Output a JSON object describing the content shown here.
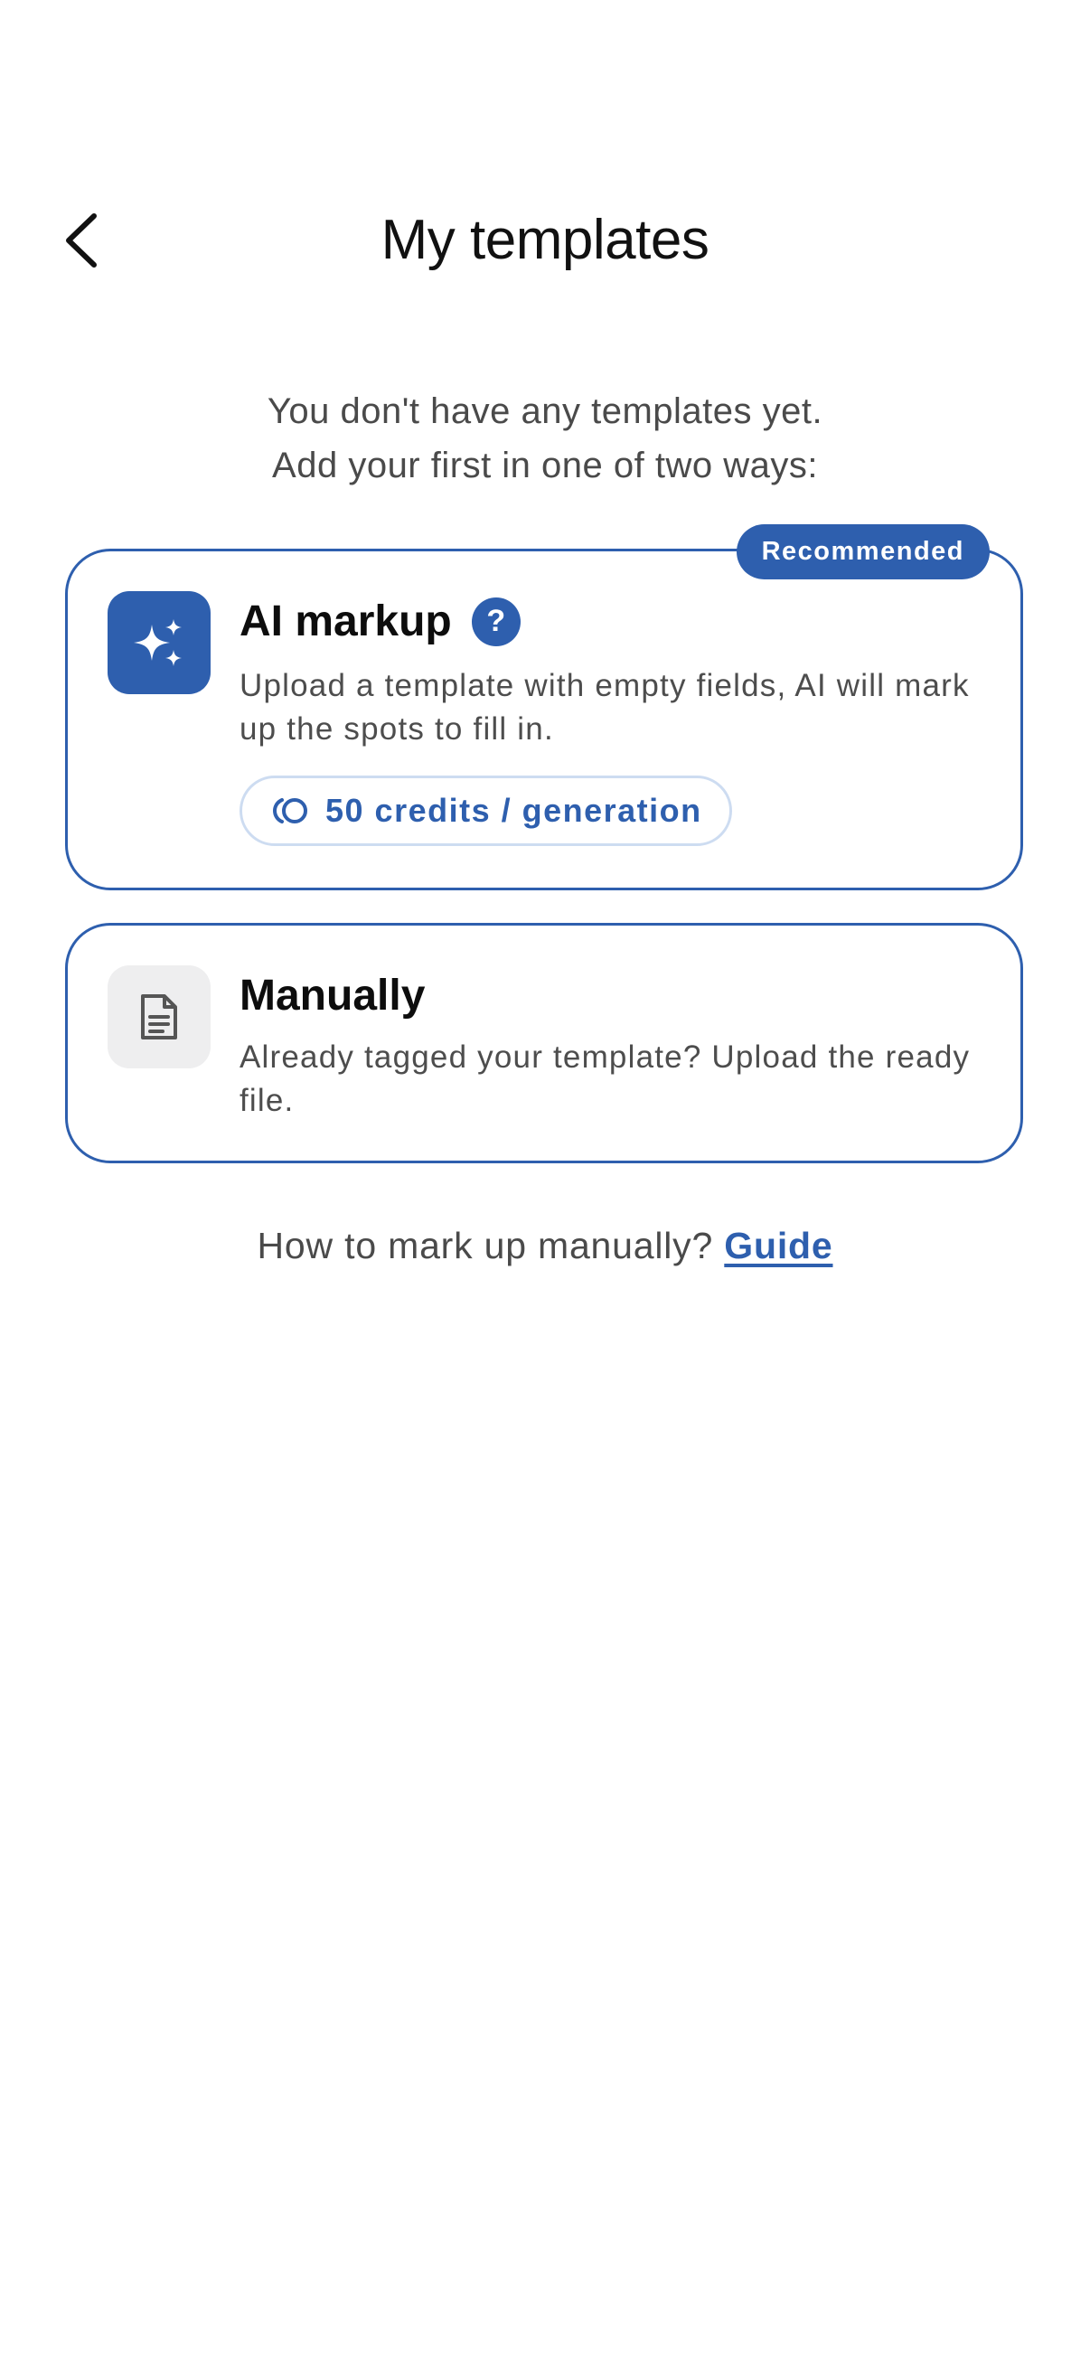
{
  "header": {
    "title": "My templates",
    "back_icon": "chevron-left-icon"
  },
  "intro": {
    "line1": "You don't have any templates yet.",
    "line2": "Add your first in one of two ways:"
  },
  "ai_card": {
    "badge": "Recommended",
    "icon": "sparkles-icon",
    "title": "AI markup",
    "help_icon": "?",
    "description": "Upload a template with empty fields, AI will mark up the spots to fill in.",
    "credits_icon": "coins-icon",
    "credits_label": "50 credits / generation"
  },
  "manual_card": {
    "icon": "document-icon",
    "title": "Manually",
    "description": "Already tagged your template? Upload the ready file."
  },
  "guide": {
    "prompt": "How to mark up manually?",
    "link_label": "Guide"
  },
  "colors": {
    "accent": "#2e5fae",
    "pill_border": "#cddcf1",
    "text_secondary": "#4d4d4d",
    "icon_bg_neutral": "#eeeeef"
  }
}
